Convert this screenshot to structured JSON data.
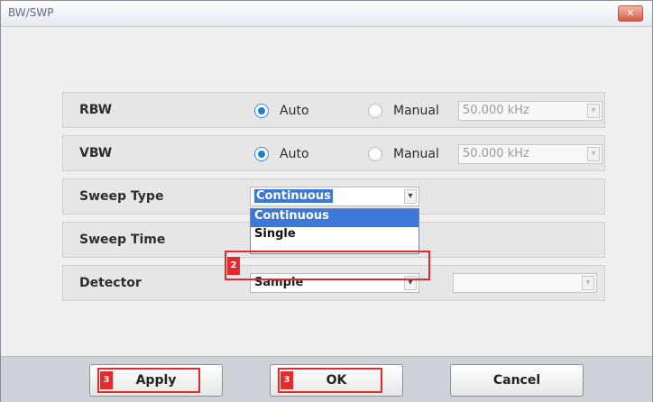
{
  "window": {
    "title": "BW/SWP",
    "close_glyph": "✕"
  },
  "rows": {
    "rbw": {
      "label": "RBW",
      "auto": "Auto",
      "manual": "Manual",
      "value": "50.000 kHz",
      "mode": "Auto"
    },
    "vbw": {
      "label": "VBW",
      "auto": "Auto",
      "manual": "Manual",
      "value": "50.000 kHz",
      "mode": "Auto"
    },
    "sweep_type": {
      "label": "Sweep Type",
      "value": "Continuous"
    },
    "sweep_time": {
      "label": "Sweep Time"
    },
    "detector": {
      "label": "Detector",
      "value": "Sample",
      "secondary_value": ""
    }
  },
  "dropdown": {
    "options": [
      "Continuous",
      "Single"
    ],
    "selected": "Continuous"
  },
  "steps": {
    "single": "2",
    "apply": "3",
    "ok": "3"
  },
  "buttons": {
    "apply": "Apply",
    "ok": "OK",
    "cancel": "Cancel"
  },
  "icons": {
    "arrow": "chevron-down-icon",
    "close": "close-icon"
  },
  "colors": {
    "accent": "#1f7fd6",
    "highlight": "#e12a2a"
  }
}
